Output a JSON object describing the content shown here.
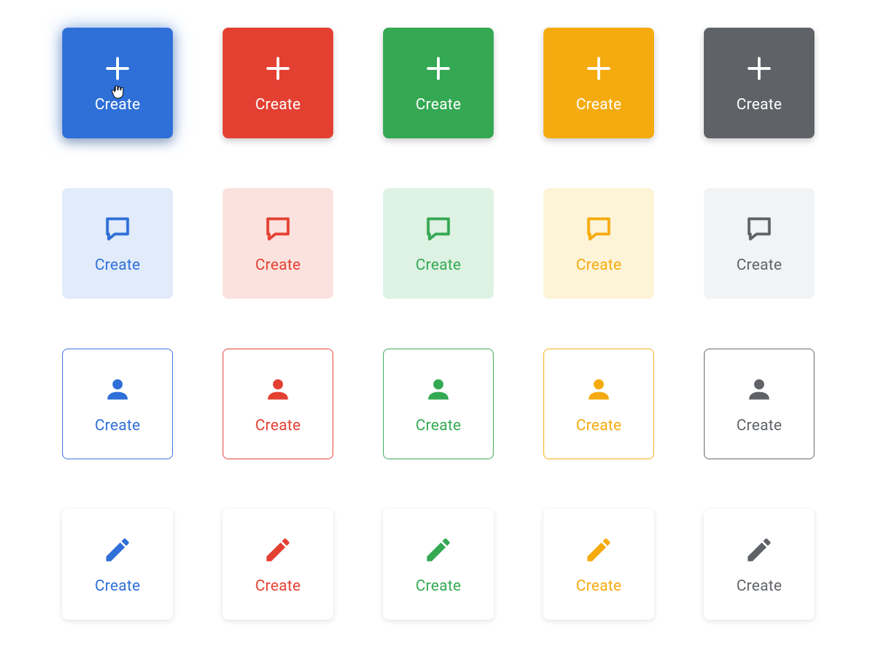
{
  "label": "Create",
  "colors": {
    "blue": {
      "base": "#2F6FD8",
      "tonal_bg": "#E1EBFA",
      "tonal_fg": "#2F6FD8"
    },
    "red": {
      "base": "#E44032",
      "tonal_bg": "#FBE2DF",
      "tonal_fg": "#E44032"
    },
    "green": {
      "base": "#34A853",
      "tonal_bg": "#DEF2E3",
      "tonal_fg": "#34A853"
    },
    "yellow": {
      "base": "#F5AB0E",
      "tonal_bg": "#FDF3D7",
      "tonal_fg": "#F5AB0E"
    },
    "gray": {
      "base": "#5F6368",
      "tonal_bg": "#F1F3F4",
      "tonal_fg": "#5F6368"
    }
  },
  "color_order": [
    "blue",
    "red",
    "green",
    "yellow",
    "gray"
  ],
  "rows": [
    {
      "variant": "filled",
      "icon": "plus"
    },
    {
      "variant": "tonal",
      "icon": "chat"
    },
    {
      "variant": "outlined",
      "icon": "person"
    },
    {
      "variant": "elevated",
      "icon": "pencil"
    }
  ],
  "hovered": {
    "row": 0,
    "col": 0
  }
}
